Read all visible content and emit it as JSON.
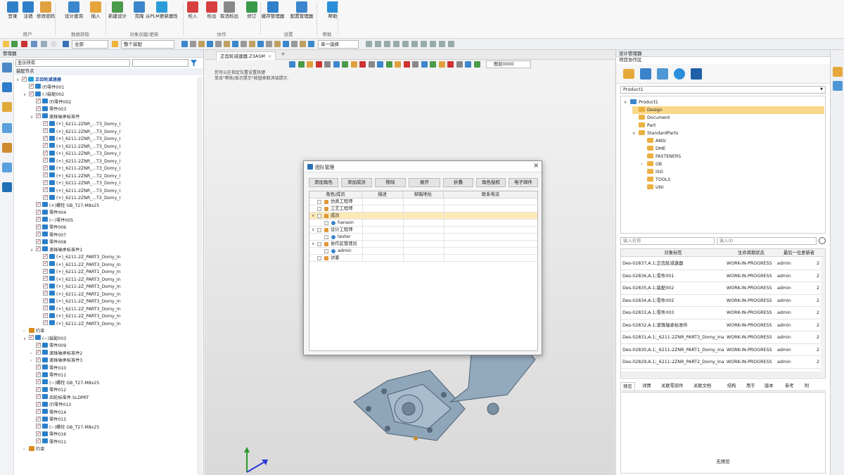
{
  "ribbon": {
    "buttons": [
      {
        "label": "登录",
        "icon": "login-icon"
      },
      {
        "label": "注销",
        "icon": "logout-icon"
      },
      {
        "label": "修改密码",
        "icon": "password-icon"
      },
      {
        "label": "设计查询",
        "icon": "design-query-icon"
      },
      {
        "label": "插入",
        "icon": "insert-icon"
      },
      {
        "label": "新建设计",
        "icon": "new-design-icon"
      },
      {
        "label": "克隆",
        "icon": "clone-icon"
      },
      {
        "label": "从PLM更新属性",
        "icon": "plm-update-icon"
      },
      {
        "label": "检入",
        "icon": "checkin-icon"
      },
      {
        "label": "检出",
        "icon": "checkout-icon"
      },
      {
        "label": "取消检出",
        "icon": "cancel-checkout-icon"
      },
      {
        "label": "修订",
        "icon": "revise-icon"
      },
      {
        "label": "缓存管理器",
        "icon": "cache-manager-icon"
      },
      {
        "label": "配置管理器",
        "icon": "config-manager-icon"
      },
      {
        "label": "帮助",
        "icon": "help-icon"
      }
    ],
    "groups": [
      "用户",
      "数据获取",
      "对象创建/更新",
      "协作",
      "设置",
      "帮助"
    ]
  },
  "toolbar2": {
    "filter_all": "全部",
    "assembly_all": "整个装配",
    "select_mode": "单一选择"
  },
  "left_panel": {
    "title": "管理器",
    "filter_value": "显示所有",
    "root_label": "装配节点",
    "tree": [
      {
        "d": 0,
        "t": "正齿轮减速器",
        "tw": "v",
        "c": "#2a9fd6"
      },
      {
        "d": 1,
        "t": "(f)零件001",
        "c": "#2a7fc9"
      },
      {
        "d": 1,
        "t": "(-)装配002",
        "tw": "v",
        "c": "#2a7fc9"
      },
      {
        "d": 2,
        "t": "(f)零件002",
        "c": "#2a7fc9"
      },
      {
        "d": 2,
        "t": "零件003",
        "c": "#2a7fc9"
      },
      {
        "d": 2,
        "t": "滚珠轴承标准件",
        "tw": "v",
        "c": "#2a7fc9"
      },
      {
        "d": 3,
        "t": "(+)_6211-2ZNR_...T3_Domy_I",
        "c": "#2a7fc9"
      },
      {
        "d": 3,
        "t": "(+)_6211-2ZNR_...T3_Domy_I",
        "c": "#2a7fc9"
      },
      {
        "d": 3,
        "t": "(+)_6211-2ZNR_...T3_Domy_I",
        "c": "#2a7fc9"
      },
      {
        "d": 3,
        "t": "(+)_6211-2ZNR_...T3_Domy_I",
        "c": "#2a7fc9"
      },
      {
        "d": 3,
        "t": "(+)_6211-2ZNR_...T3_Domy_I",
        "c": "#2a7fc9"
      },
      {
        "d": 3,
        "t": "(+)_6211-2ZNR_...T3_Domy_I",
        "c": "#2a7fc9"
      },
      {
        "d": 3,
        "t": "(+)_6211-2ZNR_...T3_Domy_I",
        "c": "#2a7fc9"
      },
      {
        "d": 3,
        "t": "(+)_6211-2ZNR_...T2_Domy_I",
        "c": "#2a7fc9"
      },
      {
        "d": 3,
        "t": "(+)_6211-2ZNR_...T3_Domy_I",
        "c": "#2a7fc9"
      },
      {
        "d": 3,
        "t": "(+)_6211-2ZNR_...T3_Domy_I",
        "c": "#2a7fc9"
      },
      {
        "d": 3,
        "t": "(+)_6211-2ZNR_...T2_Domy_I",
        "c": "#2a7fc9"
      },
      {
        "d": 2,
        "t": "(+)螺栓 GB_T27-M8x25",
        "c": "#2a7fc9"
      },
      {
        "d": 2,
        "t": "零件004",
        "c": "#2a7fc9"
      },
      {
        "d": 2,
        "t": "(~)零件005",
        "c": "#2a7fc9"
      },
      {
        "d": 2,
        "t": "零件006",
        "c": "#2a7fc9"
      },
      {
        "d": 2,
        "t": "零件007",
        "c": "#2a7fc9"
      },
      {
        "d": 2,
        "t": "零件008",
        "c": "#2a7fc9"
      },
      {
        "d": 2,
        "t": "滚珠轴承标准件1",
        "tw": "v",
        "c": "#2a7fc9"
      },
      {
        "d": 3,
        "t": "(+)_6211-2Z_PART3_Domy_In",
        "c": "#2a7fc9"
      },
      {
        "d": 3,
        "t": "(+)_6211-2Z_PART3_Domy_In",
        "c": "#2a7fc9"
      },
      {
        "d": 3,
        "t": "(+)_6211-2Z_PART1_Domy_In",
        "c": "#2a7fc9"
      },
      {
        "d": 3,
        "t": "(+)_6211-2Z_PART3_Domy_In",
        "c": "#2a7fc9"
      },
      {
        "d": 3,
        "t": "(+)_6211-2Z_PART3_Domy_In",
        "c": "#2a7fc9"
      },
      {
        "d": 3,
        "t": "(+)_6211-2Z_PART2_Domy_In",
        "c": "#2a7fc9"
      },
      {
        "d": 3,
        "t": "(+)_6211-2Z_PART3_Domy_In",
        "c": "#2a7fc9"
      },
      {
        "d": 3,
        "t": "(+)_6211-2Z_PART3_Domy_In",
        "c": "#2a7fc9"
      },
      {
        "d": 3,
        "t": "(+)_6211-2Z_PART3_Domy_In",
        "c": "#2a7fc9"
      },
      {
        "d": 3,
        "t": "(+)_6211-2Z_PART3_Domy_In",
        "c": "#2a7fc9"
      },
      {
        "d": 1,
        "t": "约束",
        "tw": ">",
        "c": "#d88a1e",
        "nochk": true
      },
      {
        "d": 1,
        "t": "(~)装配003",
        "tw": "v",
        "c": "#2a7fc9"
      },
      {
        "d": 2,
        "t": "零件009",
        "c": "#2a7fc9"
      },
      {
        "d": 2,
        "t": "滚珠轴承标准件2",
        "tw": ">",
        "c": "#2a7fc9"
      },
      {
        "d": 2,
        "t": "滚珠轴承标准件3",
        "tw": ">",
        "c": "#2a7fc9"
      },
      {
        "d": 2,
        "t": "零件010",
        "c": "#2a7fc9"
      },
      {
        "d": 2,
        "t": "零件011",
        "c": "#2a7fc9"
      },
      {
        "d": 2,
        "t": "(~)螺栓 GB_T27-M8x25",
        "c": "#2a7fc9"
      },
      {
        "d": 2,
        "t": "零件012",
        "c": "#2a7fc9"
      },
      {
        "d": 2,
        "t": "齿轮标准件.SLDPRT",
        "c": "#2a7fc9"
      },
      {
        "d": 2,
        "t": "(f)零件013",
        "c": "#2a7fc9"
      },
      {
        "d": 2,
        "t": "零件014",
        "c": "#2a7fc9"
      },
      {
        "d": 2,
        "t": "零件015",
        "c": "#2a7fc9"
      },
      {
        "d": 2,
        "t": "(~)螺栓 GB_T27-M8x25",
        "c": "#2a7fc9"
      },
      {
        "d": 2,
        "t": "零件016",
        "c": "#2a7fc9"
      },
      {
        "d": 2,
        "t": "零件011",
        "c": "#2a7fc9"
      },
      {
        "d": 1,
        "t": "约束",
        "tw": ">",
        "c": "#d88a1e",
        "nochk": true
      }
    ]
  },
  "viewport": {
    "tab_label": "正齿轮减速器.Z3ASM",
    "tab_add": "+",
    "hint1": "您可以在指定位置设置热键",
    "hint2": "单击\"帮助/显示提示\"按钮来取消该提示.",
    "layer": "图层0000"
  },
  "dialog": {
    "title": "团队管理",
    "close": "×",
    "buttons": [
      "添加角色",
      "添加成员",
      "移除",
      "展开",
      "折叠",
      "角色授权",
      "电子邮件"
    ],
    "headers": [
      "角色/成员",
      "描述",
      "邮箱地址",
      "联系电话"
    ],
    "rows": [
      {
        "tw": "",
        "label": "仿真工程师",
        "indent": 0,
        "type": "role"
      },
      {
        "tw": "",
        "label": "工艺工程师",
        "indent": 0,
        "type": "role"
      },
      {
        "tw": "v",
        "label": "成员",
        "indent": 0,
        "type": "role",
        "selected": true
      },
      {
        "tw": "",
        "label": "hanson",
        "indent": 1,
        "type": "member"
      },
      {
        "tw": "v",
        "label": "设计工程师",
        "indent": 0,
        "type": "role"
      },
      {
        "tw": "",
        "label": "tester",
        "indent": 1,
        "type": "member"
      },
      {
        "tw": "v",
        "label": "协作区管理员",
        "indent": 0,
        "type": "role"
      },
      {
        "tw": "",
        "label": "admin",
        "indent": 1,
        "type": "member"
      },
      {
        "tw": "",
        "label": "访客",
        "indent": 0,
        "type": "role"
      }
    ]
  },
  "right_panel": {
    "title": "设计管理器",
    "subtitle": "项目协作区",
    "product_select": "Product1",
    "folders": [
      {
        "d": 0,
        "t": "Product1",
        "tw": "v",
        "icon": "product"
      },
      {
        "d": 1,
        "t": "Design",
        "sel": true
      },
      {
        "d": 1,
        "t": "Document"
      },
      {
        "d": 1,
        "t": "Part"
      },
      {
        "d": 1,
        "t": "StandardParts",
        "tw": "v"
      },
      {
        "d": 2,
        "t": "ANSI"
      },
      {
        "d": 2,
        "t": "DME"
      },
      {
        "d": 2,
        "t": "FASTENERS"
      },
      {
        "d": 2,
        "t": "GB",
        "tw": ">"
      },
      {
        "d": 2,
        "t": "ISO"
      },
      {
        "d": 2,
        "t": "TOOLS"
      },
      {
        "d": 2,
        "t": "UNI"
      }
    ],
    "search_name_placeholder": "输入名称",
    "search_id_placeholder": "输入ID",
    "table_headers": [
      "对象标签",
      "生命周期状态",
      "最后一位更新者"
    ],
    "table_rows": [
      {
        "label": "Des-02837,A.1;正齿轮减速器",
        "state": "WORK-IN-PROGRESS",
        "user": "admin",
        "extra": "2"
      },
      {
        "label": "Des-02836,A.1;零件001",
        "state": "WORK-IN-PROGRESS",
        "user": "admin",
        "extra": "2"
      },
      {
        "label": "Des-02835,A.1;装配002",
        "state": "WORK-IN-PROGRESS",
        "user": "admin",
        "extra": "2"
      },
      {
        "label": "Des-02834,A.1;零件002",
        "state": "WORK-IN-PROGRESS",
        "user": "admin",
        "extra": "2"
      },
      {
        "label": "Des-02833,A.1;零件003",
        "state": "WORK-IN-PROGRESS",
        "user": "admin",
        "extra": "2"
      },
      {
        "label": "Des-02832,A.1;滚珠轴承标准件",
        "state": "WORK-IN-PROGRESS",
        "user": "admin",
        "extra": "2"
      },
      {
        "label": "Des-02831,A.1;_6211-2ZNR_PART3_Domy_Ina",
        "state": "WORK-IN-PROGRESS",
        "user": "admin",
        "extra": "2"
      },
      {
        "label": "Des-02830,A.1;_6211-2ZNR_PART1_Domy_Ina",
        "state": "WORK-IN-PROGRESS",
        "user": "admin",
        "extra": "2"
      },
      {
        "label": "Des-02829,A.1;_6211-2ZNR_PART2_Domy_Ina",
        "state": "WORK-IN-PROGRESS",
        "user": "admin",
        "extra": "2"
      }
    ],
    "bottom_tabs": [
      "预览",
      "详情",
      "关联零部件",
      "关联文档",
      "结构",
      "用于",
      "版本",
      "参考",
      "附"
    ],
    "no_preview": "无预览"
  }
}
